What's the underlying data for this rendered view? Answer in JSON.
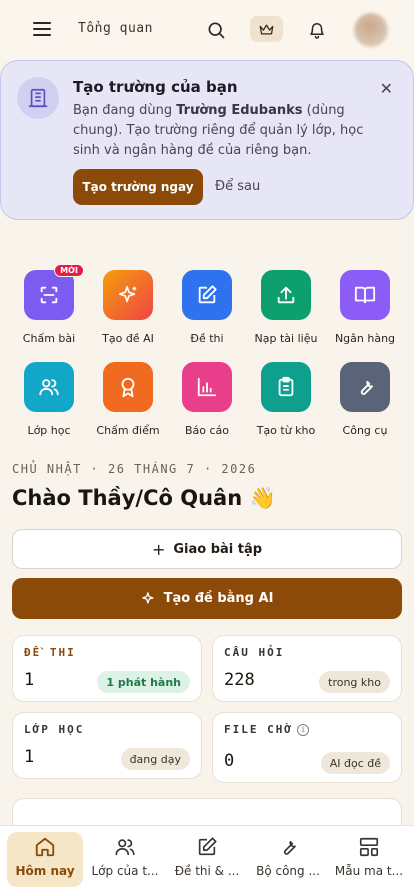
{
  "header": {
    "title": "Tổng quan",
    "icons": [
      "menu-icon",
      "search-icon",
      "crown-icon",
      "bell-icon",
      "avatar"
    ]
  },
  "promo": {
    "title": "Tạo trường của bạn",
    "text_prefix": "Bạn đang dùng ",
    "text_bold": "Trường Edubanks",
    "text_suffix": " (dùng chung). Tạo trường riêng để quản lý lớp, học sinh và ngân hàng đề của riêng bạn.",
    "primary_button": "Tạo trường ngay",
    "secondary_button": "Để sau"
  },
  "shortcuts": [
    {
      "label": "Chấm bài",
      "icon": "scan-icon",
      "color": "#7c5cf0",
      "badge": "MỚI"
    },
    {
      "label": "Tạo đề AI",
      "icon": "sparkles-icon",
      "color": "#f06a1f"
    },
    {
      "label": "Đề thi",
      "icon": "edit-icon",
      "color": "#2f72ef"
    },
    {
      "label": "Nạp tài liệu",
      "icon": "upload-icon",
      "color": "#0e9f6e"
    },
    {
      "label": "Ngân hàng",
      "icon": "book-icon",
      "color": "#8b5cf6"
    },
    {
      "label": "Lớp học",
      "icon": "users-icon",
      "color": "#12a6c8"
    },
    {
      "label": "Chấm điểm",
      "icon": "award-icon",
      "color": "#f06a1f"
    },
    {
      "label": "Báo cáo",
      "icon": "chart-icon",
      "color": "#e93f8a"
    },
    {
      "label": "Tạo từ kho",
      "icon": "clipboard-icon",
      "color": "#0f9f8f"
    },
    {
      "label": "Công cụ",
      "icon": "wrench-icon",
      "color": "#5a6478"
    }
  ],
  "date_line": "CHỦ NHẬT · 26 THÁNG 7 · 2026",
  "greeting": "Chào Thầy/Cô Quân 👋",
  "actions": {
    "assign": "Giao bài tập",
    "ai_create": "Tạo đề bằng AI"
  },
  "stats": [
    {
      "label": "ĐỀ THI",
      "value": "1",
      "pill": "1 phát hành"
    },
    {
      "label": "CÂU HỎI",
      "value": "228",
      "pill": "trong kho"
    },
    {
      "label": "LỚP HỌC",
      "value": "1",
      "pill": "đang dạy"
    },
    {
      "label": "FILE CHỜ",
      "value": "0",
      "pill": "AI đọc đề"
    }
  ],
  "bottom_nav": [
    {
      "label": "Hôm nay",
      "icon": "home-icon",
      "active": true
    },
    {
      "label": "Lớp của t...",
      "icon": "users-icon",
      "active": false
    },
    {
      "label": "Đề thi & ...",
      "icon": "edit-icon",
      "active": false
    },
    {
      "label": "Bộ công ...",
      "icon": "wrench-icon",
      "active": false
    },
    {
      "label": "Mẫu ma t...",
      "icon": "template-icon",
      "active": false
    }
  ],
  "colors": {
    "accent": "#8b4a07",
    "background": "#f8f4ec"
  }
}
